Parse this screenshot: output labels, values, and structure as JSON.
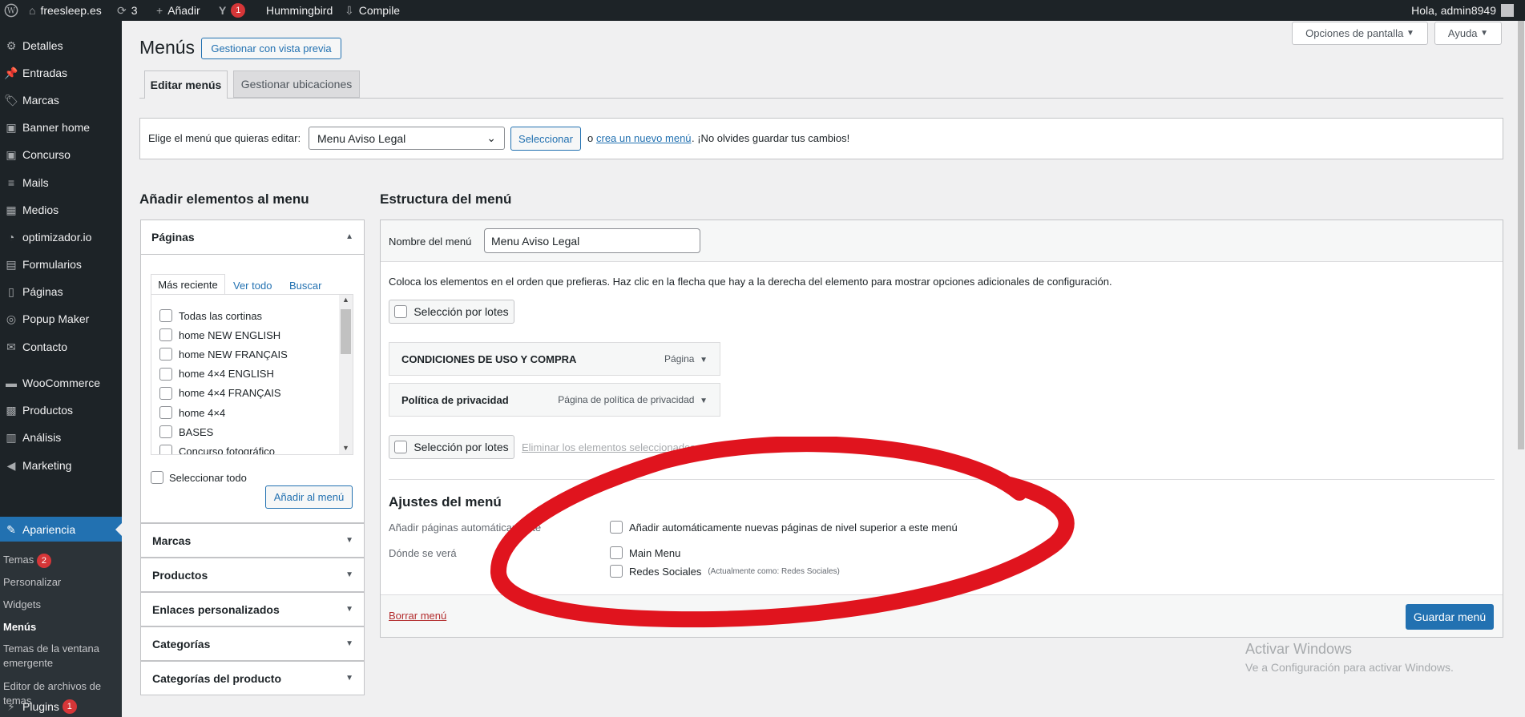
{
  "adminbar": {
    "site": "freesleep.es",
    "updates": "3",
    "add": "Añadir",
    "yoast_count": "1",
    "hummingbird": "Hummingbird",
    "compile": "Compile",
    "greeting": "Hola, admin8949"
  },
  "sidebar": {
    "items": [
      {
        "label": "Detalles",
        "icon": "gear-icon"
      },
      {
        "label": "Entradas",
        "icon": "pin-icon"
      },
      {
        "label": "Marcas",
        "icon": "tag-icon"
      },
      {
        "label": "Banner home",
        "icon": "image-icon"
      },
      {
        "label": "Concurso",
        "icon": "image-icon"
      },
      {
        "label": "Mails",
        "icon": "list-icon"
      },
      {
        "label": "Medios",
        "icon": "media-icon"
      },
      {
        "label": "optimizador.io",
        "icon": "gauge-icon"
      },
      {
        "label": "Formularios",
        "icon": "form-icon"
      },
      {
        "label": "Páginas",
        "icon": "page-icon"
      },
      {
        "label": "Popup Maker",
        "icon": "popup-icon"
      },
      {
        "label": "Contacto",
        "icon": "mail-icon"
      },
      {
        "label": "WooCommerce",
        "icon": "woo-icon"
      },
      {
        "label": "Productos",
        "icon": "box-icon"
      },
      {
        "label": "Análisis",
        "icon": "chart-icon"
      },
      {
        "label": "Marketing",
        "icon": "megaphone-icon"
      }
    ],
    "current": "Apariencia",
    "sub": {
      "temas": "Temas",
      "temas_badge": "2",
      "personalizar": "Personalizar",
      "widgets": "Widgets",
      "menus": "Menús",
      "ventana": "Temas de la ventana emergente",
      "editor": "Editor de archivos de temas"
    },
    "plugins": "Plugins",
    "plugins_badge": "1"
  },
  "header": {
    "screen_options": "Opciones de pantalla",
    "help": "Ayuda",
    "title": "Menús",
    "preview_btn": "Gestionar con vista previa"
  },
  "tabs": [
    "Editar menús",
    "Gestionar ubicaciones"
  ],
  "select_bar": {
    "label": "Elige el menú que quieras editar:",
    "selected": "Menu Aviso Legal",
    "select_btn": "Seleccionar",
    "or": "o",
    "create_link": "crea un nuevo menú",
    "tail": ". ¡No olvides guardar tus cambios!"
  },
  "left": {
    "heading": "Añadir elementos al menu",
    "pages_title": "Páginas",
    "subtabs": [
      "Más reciente",
      "Ver todo",
      "Buscar"
    ],
    "pages": [
      "Todas las cortinas",
      "home NEW ENGLISH",
      "home NEW FRANÇAIS",
      "home 4×4 ENGLISH",
      "home 4×4 FRANÇAIS",
      "home 4×4",
      "BASES",
      "Concurso fotográfico"
    ],
    "select_all": "Seleccionar todo",
    "add_btn": "Añadir al menú",
    "sections": [
      "Marcas",
      "Productos",
      "Enlaces personalizados",
      "Categorías",
      "Categorías del producto"
    ]
  },
  "right": {
    "heading": "Estructura del menú",
    "name_label": "Nombre del menú",
    "name_value": "Menu Aviso Legal",
    "instructions": "Coloca los elementos en el orden que prefieras. Haz clic en la flecha que hay a la derecha del elemento para mostrar opciones adicionales de configuración.",
    "bulk": "Selección por lotes",
    "delete_selected": "Eliminar los elementos seleccionados",
    "items": [
      {
        "title": "CONDICIONES DE USO Y COMPRA",
        "type": "Página"
      },
      {
        "title": "Política de privacidad",
        "type": "Página de política de privacidad"
      }
    ],
    "settings_heading": "Ajustes del menú",
    "auto_add_label": "Añadir páginas automáticamente",
    "auto_add_opt": "Añadir automáticamente nuevas páginas de nivel superior a este menú",
    "where_label": "Dónde se verá",
    "loc1": "Main Menu",
    "loc2": "Redes Sociales",
    "loc2_note": "(Actualmente como: Redes Sociales)",
    "delete_menu": "Borrar menú",
    "save_btn": "Guardar menú"
  },
  "watermark": {
    "line1": "Activar Windows",
    "line2": "Ve a Configuración para activar Windows."
  },
  "colors": {
    "accent": "#2271b1",
    "annotation": "#e0141e",
    "sidebar": "#1d2327"
  }
}
